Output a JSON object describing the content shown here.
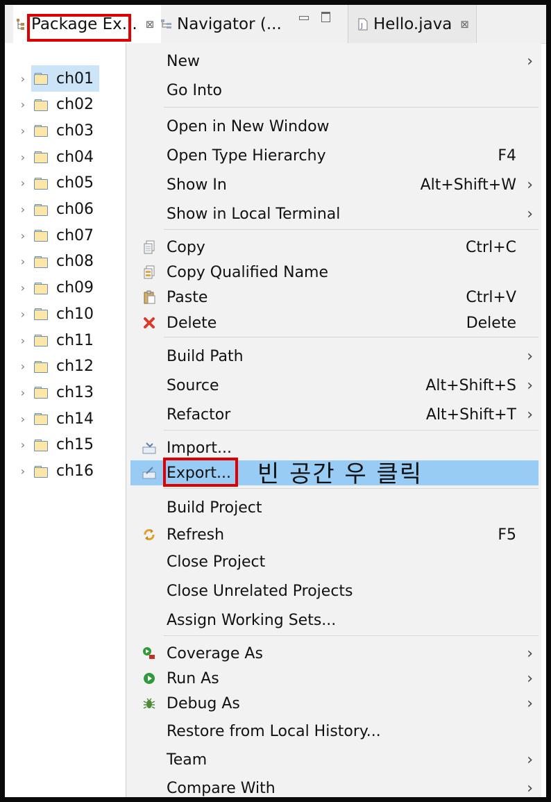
{
  "tabs": {
    "package_explorer": "Package Ex...",
    "navigator": "Navigator (...",
    "hello": "Hello.java",
    "close_glyph": "⊠"
  },
  "tree": {
    "items": [
      "ch01",
      "ch02",
      "ch03",
      "ch04",
      "ch05",
      "ch06",
      "ch07",
      "ch08",
      "ch09",
      "ch10",
      "ch11",
      "ch12",
      "ch13",
      "ch14",
      "ch15",
      "ch16"
    ],
    "selected": "ch01"
  },
  "menu": {
    "new": "New",
    "go_into": "Go Into",
    "open_new_window": "Open in New Window",
    "open_type_hierarchy": "Open Type Hierarchy",
    "open_type_hierarchy_sc": "F4",
    "show_in": "Show In",
    "show_in_sc": "Alt+Shift+W",
    "show_local_terminal": "Show in Local Terminal",
    "copy": "Copy",
    "copy_sc": "Ctrl+C",
    "copy_qualified": "Copy Qualified Name",
    "paste": "Paste",
    "paste_sc": "Ctrl+V",
    "delete": "Delete",
    "delete_sc": "Delete",
    "build_path": "Build Path",
    "source": "Source",
    "source_sc": "Alt+Shift+S",
    "refactor": "Refactor",
    "refactor_sc": "Alt+Shift+T",
    "import": "Import...",
    "export": "Export...",
    "build_project": "Build Project",
    "refresh": "Refresh",
    "refresh_sc": "F5",
    "close_project": "Close Project",
    "close_unrelated": "Close Unrelated Projects",
    "assign_working_sets": "Assign Working Sets...",
    "coverage_as": "Coverage As",
    "run_as": "Run As",
    "debug_as": "Debug As",
    "restore_history": "Restore from Local History...",
    "team": "Team",
    "compare_with": "Compare With",
    "arrow": "›"
  },
  "annotation": "빈 공간 우 클릭",
  "colors": {
    "highlight": "#99ccf5",
    "annotation_box": "#e00000",
    "selection": "#cce4f7"
  }
}
